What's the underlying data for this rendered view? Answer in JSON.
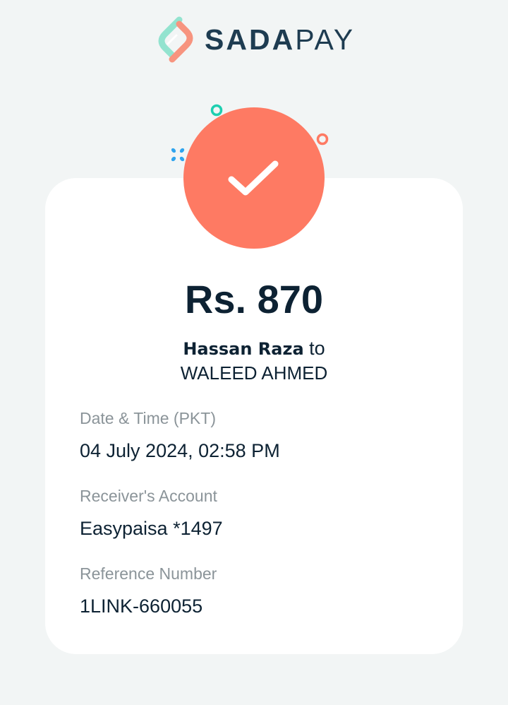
{
  "brand": {
    "name_bold": "SADA",
    "name_light": "PAY",
    "logo_icon": "sadapay-logo-icon",
    "colors": {
      "navy": "#1e3c51",
      "coral": "#fe7a63",
      "teal": "#1ecfb0",
      "blue": "#2fa4ee"
    }
  },
  "status": {
    "icon": "check-icon"
  },
  "transaction": {
    "amount": "Rs. 870",
    "sender": "Hassan Raza",
    "connector": "to",
    "receiver": "WALEED AHMED"
  },
  "details": [
    {
      "label": "Date & Time (PKT)",
      "value": "04 July 2024, 02:58 PM"
    },
    {
      "label": "Receiver's Account",
      "value": "Easypaisa *1497"
    },
    {
      "label": "Reference Number",
      "value": "1LINK-660055"
    }
  ]
}
